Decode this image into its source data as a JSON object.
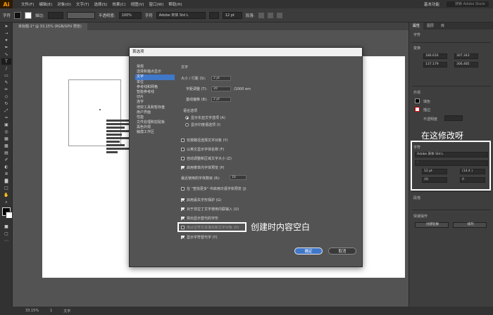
{
  "app": {
    "logo": "Ai",
    "menus": [
      "文件(F)",
      "编辑(E)",
      "对象(O)",
      "文字(T)",
      "选择(S)",
      "效果(C)",
      "视图(V)",
      "窗口(W)",
      "帮助(H)"
    ],
    "workspace": "基本功能",
    "search_placeholder": "搜索 Adobe Stock"
  },
  "controlbar": {
    "mode": "字符",
    "stroke_label": "描边:",
    "opacity_label": "不透明度:",
    "opacity_value": "100%",
    "font_name": "Adobe 宋体 Std L",
    "font_size": "12 pt",
    "paragraph_label": "段落:"
  },
  "document_tab": {
    "title": "未标题-1* @ 33.15% (RGB/GPU 预览)"
  },
  "dialog": {
    "title": "首选项",
    "nav": [
      "常规",
      "选择和锚点显示",
      "文字",
      "单位",
      "参考线和网格",
      "智能参考线",
      "切片",
      "连字",
      "增效工具和暂存盘",
      "用户界面",
      "性能",
      "文件处理和剪贴板",
      "黑色外观",
      "触摸工作区"
    ],
    "active_nav": "文字",
    "section_title": "文字",
    "size_leading_label": "大小 / 行距 (S):",
    "size_leading_value": "2 pt",
    "tracking_label": "字距调整 (T):",
    "tracking_value": "20",
    "tracking_unit": "/1000 em",
    "baseline_label": "基线偏移 (B):",
    "baseline_value": "2 pt",
    "language_label": "语言选项",
    "radio_options": [
      "显示东亚文字选项 (A)",
      "显示印度语选项 (I)"
    ],
    "checkboxes": [
      {
        "label": "仅按路径选择文字对象 (Y)",
        "checked": false
      },
      {
        "label": "以英文显示字体名称 (F)",
        "checked": false
      },
      {
        "label": "自动调整新区域文字大小 (Z)",
        "checked": false
      },
      {
        "label": "启用菜单内字体预览 (P)",
        "checked": true
      }
    ],
    "recent_fonts_label": "最近使用的字体数目 (R):",
    "recent_fonts_value": "10",
    "more_find_label": "在 \"查找更多\" 中启用日语字体预览 (J)",
    "checkboxes2": [
      {
        "label": "启用丢失字形保护 (G)",
        "checked": true
      },
      {
        "label": "对于非拉丁文字使用内联输入 (U)",
        "checked": true
      },
      {
        "label": "突出显示替代的字形",
        "checked": true
      },
      {
        "label": "用占位符文本填充新文字对象 (O)",
        "checked": false
      },
      {
        "label": "显示字符替代字 (Y)",
        "checked": true
      }
    ],
    "ok_label": "确定",
    "cancel_label": "取消"
  },
  "annotations": {
    "new_text": "创建时内容空白",
    "change_here": "在这修改呀"
  },
  "rightpanel": {
    "tabs": [
      "属性",
      "图层",
      "库"
    ],
    "section_font": "字符",
    "transform_label": "变换",
    "x_value": "186.616",
    "y_value": "137.179",
    "w_value": "307.343",
    "h_value": "306.485",
    "appearance_label": "外观",
    "fill_label": "填色",
    "stroke_label": "描边",
    "opacity_label": "不透明度",
    "char_label": "字符",
    "font_value": "Adobe 宋体 Std L",
    "style_value": "-",
    "size_value": "12 pt",
    "leading_value": "(14.4 )",
    "tracking_value": "(0)",
    "kerning_value": "0",
    "paragraph_label": "段落",
    "quick_actions_label": "快速操作",
    "btn1": "创建轮廓",
    "btn2": "排列"
  },
  "statusbar": {
    "zoom": "33.15%",
    "page": "1",
    "tool": "文字"
  }
}
